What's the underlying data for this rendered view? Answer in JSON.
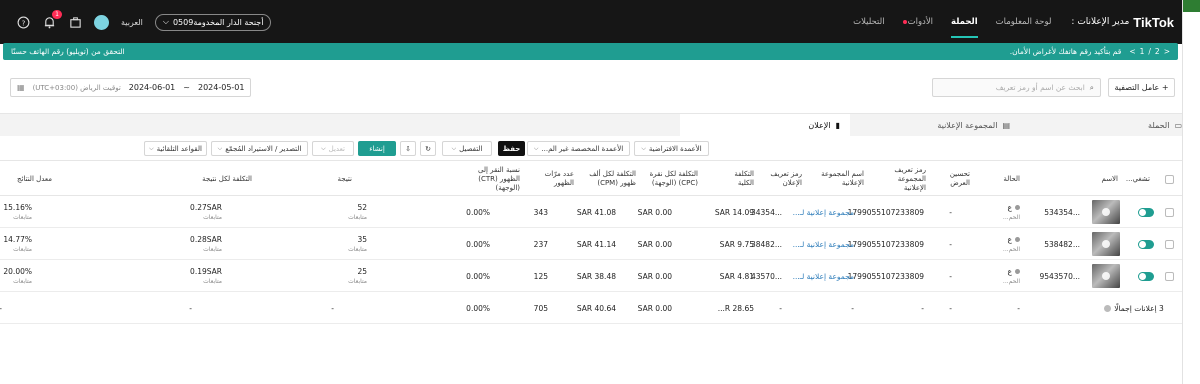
{
  "header": {
    "brand": "TikTok",
    "brand_sub": "مدير الإعلانات :",
    "nav": [
      {
        "label": "لوحة المعلومات",
        "active": false,
        "dot": false
      },
      {
        "label": "الحملة",
        "active": true,
        "dot": false
      },
      {
        "label": "الأدوات",
        "active": false,
        "dot": true
      },
      {
        "label": "التحليلات",
        "active": false,
        "dot": false
      }
    ],
    "language": "العربية",
    "account": "أجنحة الدار المخدومة0509",
    "notification_count": "1"
  },
  "notice": {
    "text": "قم بتأكيد رقم هاتفك لأغراض الأمان.",
    "action": "التحقق من (تويليو) رقم الهاتف حسنًا",
    "page": "1",
    "pages": "2"
  },
  "date_range": {
    "start": "2024-05-01",
    "sep": "~",
    "end": "2024-06-01",
    "timezone": "(UTC+03:00) توقيت الرياض"
  },
  "search": {
    "placeholder": "ابحث عن اسم أو رمز تعريف"
  },
  "filter_button": "+ عامل التصفية",
  "tabs": [
    {
      "label": "الحملة",
      "active": false
    },
    {
      "label": "المجموعة الإعلانية",
      "active": false
    },
    {
      "label": "الإعلان",
      "active": true
    }
  ],
  "toolbar": {
    "default_columns": "الأعمدة الافتراضية",
    "custom_columns": "الأعمدة المخصصة غير الم...",
    "save": "حفظ",
    "breakdown": "التفصيل",
    "create": "إنشاء",
    "edit": "تعديل",
    "export": "التصدير / الاستيراد المُجمّع",
    "rules": "القواعد التلقائية"
  },
  "columns": {
    "switch": "تشغي...",
    "name": "الاسم",
    "status": "الحالة",
    "optimize": "تحسين العرض",
    "adgroup_id": "رمز تعريف المجموعة الإعلانية",
    "adgroup_name": "اسم المجموعة الإعلانية",
    "ad_id": "رمز تعريف الإعلان",
    "cost": "التكلفة الكلية",
    "cpc": "التكلفة لكل نقرة (CPC) (الوجهة)",
    "cpm": "التكلفة لكل ألف ظهور (CPM)",
    "impressions": "عدد مرّات الظهور",
    "ctr": "نسبة النقر إلى الظهور (CTR) (الوجهة)",
    "result": "نتيجة",
    "cost_per_result": "التكلفة لكل نتيجة",
    "result_rate": "معدل النتائج"
  },
  "rows": [
    {
      "name": "...534354",
      "status": "ع",
      "status_sub": "الحم...",
      "optimize": "-",
      "adgroup_id": "1799055107233809",
      "adgroup_name": "مجموعة إعلانية لـ...",
      "ad_id": "...34354",
      "cost": "SAR 14.09",
      "cpc": "SAR 0.00",
      "cpm": "SAR 41.08",
      "impressions": "343",
      "ctr": "0.00%",
      "result": "52",
      "result_sub": "متابعات",
      "cpr": "0.27SAR",
      "cpr_sub": "متابعات",
      "rate": "15.16%",
      "rate_sub": "متابعات"
    },
    {
      "name": "...538482",
      "status": "ع",
      "status_sub": "الحم...",
      "optimize": "-",
      "adgroup_id": "1799055107233809",
      "adgroup_name": "مجموعة إعلانية لـ...",
      "ad_id": "...38482",
      "cost": "SAR 9.75",
      "cpc": "SAR 0.00",
      "cpm": "SAR 41.14",
      "impressions": "237",
      "ctr": "0.00%",
      "result": "35",
      "result_sub": "متابعات",
      "cpr": "0.28SAR",
      "cpr_sub": "متابعات",
      "rate": "14.77%",
      "rate_sub": "متابعات"
    },
    {
      "name": "...9543570",
      "status": "ع",
      "status_sub": "الحم...",
      "optimize": "-",
      "adgroup_id": "1799055107233809",
      "adgroup_name": "مجموعة إعلانية لـ...",
      "ad_id": "...43570",
      "cost": "SAR 4.81",
      "cpc": "SAR 0.00",
      "cpm": "SAR 38.48",
      "impressions": "125",
      "ctr": "0.00%",
      "result": "25",
      "result_sub": "متابعات",
      "cpr": "0.19SAR",
      "cpr_sub": "متابعات",
      "rate": "20.00%",
      "rate_sub": "متابعات"
    }
  ],
  "totals": {
    "label": "3 إعلانات إجمالًا",
    "status": "-",
    "optimize": "-",
    "adgroup_id": "-",
    "adgroup_name": "-",
    "ad_id": "-",
    "cost": "R 28.65...",
    "cpc": "SAR 0.00",
    "cpm": "SAR 40.64",
    "impressions": "705",
    "ctr": "0.00%",
    "result": "-",
    "cpr": "-",
    "rate": "-"
  }
}
